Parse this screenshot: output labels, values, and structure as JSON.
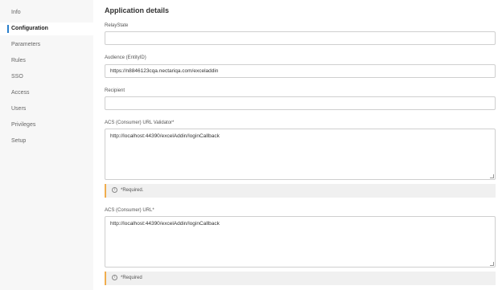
{
  "sidebar": {
    "items": [
      {
        "label": "Info"
      },
      {
        "label": "Configuration",
        "active": true
      },
      {
        "label": "Parameters"
      },
      {
        "label": "Rules"
      },
      {
        "label": "SSO"
      },
      {
        "label": "Access"
      },
      {
        "label": "Users"
      },
      {
        "label": "Privileges"
      },
      {
        "label": "Setup"
      }
    ]
  },
  "main": {
    "title": "Application details",
    "fields": {
      "relaystate": {
        "label": "RelayState",
        "value": ""
      },
      "audience": {
        "label": "Audience (EntityID)",
        "value": "https://n8846123cqa.nectariqa.com/exceladdin"
      },
      "recipient": {
        "label": "Recipient",
        "value": ""
      },
      "acs_validator": {
        "label": "ACS (Consumer) URL Validator*",
        "value": "http://localhost:44390/excelAddin/loginCallback",
        "notice": "*Required."
      },
      "acs_url": {
        "label": "ACS (Consumer) URL*",
        "value": "http://localhost:44390/excelAddin/loginCallback",
        "notice": "*Required"
      }
    }
  },
  "colors": {
    "sidebar_bg": "#f7f7f7",
    "active_indicator": "#2a7fcb",
    "notice_accent": "#f0ad4e"
  }
}
